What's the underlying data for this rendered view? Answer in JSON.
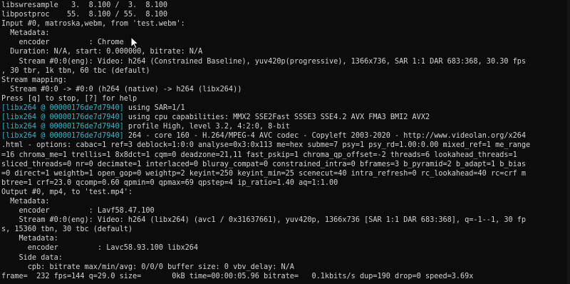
{
  "terminal": {
    "lines": [
      {
        "text": "libswresample   3.  8.100 /  3.  8.100"
      },
      {
        "text": "libpostproc    55.  8.100 / 55.  8.100"
      },
      {
        "text": "Input #0, matroska,webm, from 'test.webm':"
      },
      {
        "text": "  Metadata:"
      },
      {
        "text": "    encoder         : Chrome"
      },
      {
        "text": "  Duration: N/A, start: 0.000000, bitrate: N/A"
      },
      {
        "text": "    Stream #0:0(eng): Video: h264 (Constrained Baseline), yuv420p(progressive), 1366x736, SAR 1:1 DAR 683:368, 30.30 fps"
      },
      {
        "text": ", 30 tbr, 1k tbn, 60 tbc (default)"
      },
      {
        "text": "Stream mapping:"
      },
      {
        "text": "  Stream #0:0 -> #0:0 (h264 (native) -> h264 (libx264))"
      },
      {
        "text": "Press [q] to stop, [?] for help"
      },
      {
        "tag": "[libx264 @ 00000176de7d7940]",
        "text": " using SAR=1/1"
      },
      {
        "tag": "[libx264 @ 00000176de7d7940]",
        "text": " using cpu capabilities: MMX2 SSE2Fast SSSE3 SSE4.2 AVX FMA3 BMI2 AVX2"
      },
      {
        "tag": "[libx264 @ 00000176de7d7940]",
        "text": " profile High, level 3.2, 4:2:0, 8-bit"
      },
      {
        "tag": "[libx264 @ 00000176de7d7940]",
        "text": " 264 - core 160 - H.264/MPEG-4 AVC codec - Copyleft 2003-2020 - http://www.videolan.org/x264"
      },
      {
        "text": ".html - options: cabac=1 ref=3 deblock=1:0:0 analyse=0x3:0x113 me=hex subme=7 psy=1 psy_rd=1.00:0.00 mixed_ref=1 me_range"
      },
      {
        "text": "=16 chroma_me=1 trellis=1 8x8dct=1 cqm=0 deadzone=21,11 fast_pskip=1 chroma_qp_offset=-2 threads=6 lookahead_threads=1"
      },
      {
        "text": "sliced_threads=0 nr=0 decimate=1 interlaced=0 bluray_compat=0 constrained_intra=0 bframes=3 b_pyramid=2 b_adapt=1 b_bias"
      },
      {
        "text": "=0 direct=1 weightb=1 open_gop=0 weightp=2 keyint=250 keyint_min=25 scenecut=40 intra_refresh=0 rc_lookahead=40 rc=crf m"
      },
      {
        "text": "btree=1 crf=23.0 qcomp=0.60 qpmin=0 qpmax=69 qpstep=4 ip_ratio=1.40 aq=1:1.00"
      },
      {
        "text": "Output #0, mp4, to 'test.mp4':"
      },
      {
        "text": "  Metadata:"
      },
      {
        "text": "    encoder         : Lavf58.47.100"
      },
      {
        "text": "    Stream #0:0(eng): Video: h264 (libx264) (avc1 / 0x31637661), yuv420p, 1366x736 [SAR 1:1 DAR 683:368], q=-1--1, 30 fp"
      },
      {
        "text": "s, 15360 tbn, 30 tbc (default)"
      },
      {
        "text": "    Metadata:"
      },
      {
        "text": "      encoder         : Lavc58.93.100 libx264"
      },
      {
        "text": "    Side data:"
      },
      {
        "text": "      cpb: bitrate max/min/avg: 0/0/0 buffer size: 0 vbv_delay: N/A"
      },
      {
        "text": "frame=  232 fps=144 q=29.0 size=       0kB time=00:00:05.96 bitrate=   0.1kbits/s dup=190 drop=0 speed=3.69x"
      }
    ]
  },
  "colors": {
    "background": "#0c0c0c",
    "text": "#d4d4d4",
    "tag": "#2fb7c9"
  },
  "icons": {
    "cursor": "mouse-pointer-icon"
  }
}
